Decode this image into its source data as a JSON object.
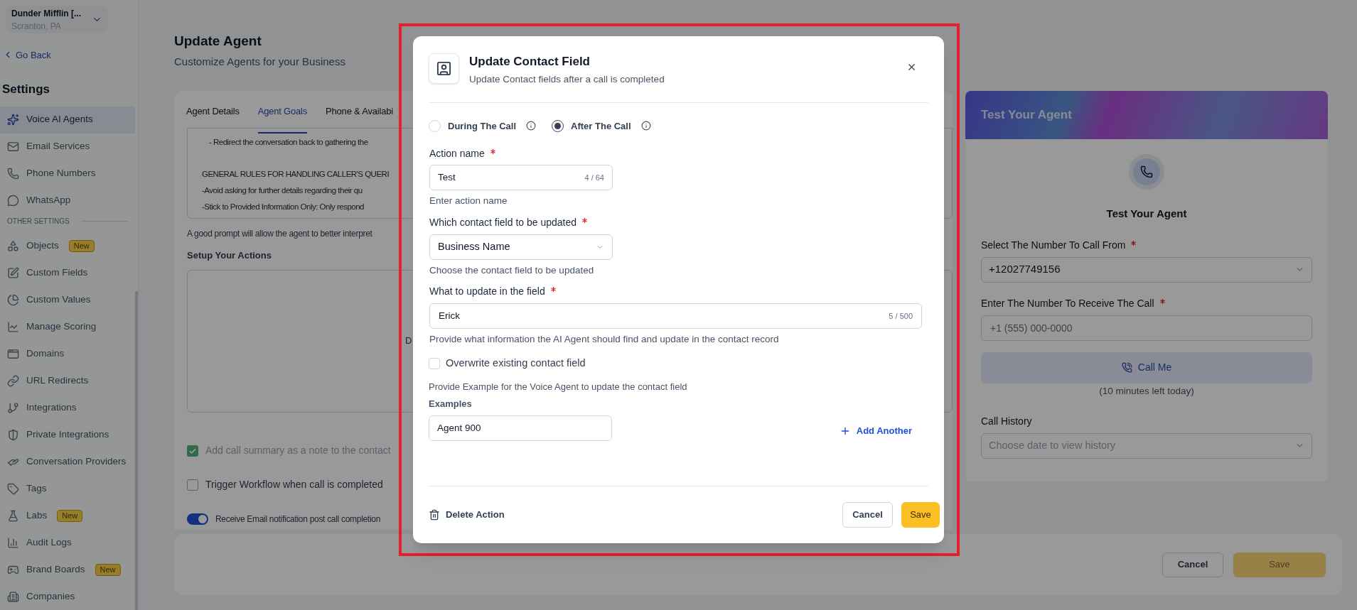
{
  "sidebar": {
    "account": {
      "name": "Dunder Mifflin [...",
      "location": "Scranton, PA"
    },
    "back_link": "Go Back",
    "title": "Settings",
    "items": [
      {
        "label": "Voice AI Agents",
        "selected": true
      },
      {
        "label": "Email Services",
        "selected": false
      },
      {
        "label": "Phone Numbers",
        "selected": false
      },
      {
        "label": "WhatsApp",
        "selected": false
      }
    ],
    "section_label": "OTHER SETTINGS",
    "other_items": [
      {
        "label": "Objects",
        "badge": "New",
        "selected": false
      },
      {
        "label": "Custom Fields",
        "selected": false
      },
      {
        "label": "Custom Values",
        "selected": false
      },
      {
        "label": "Manage Scoring",
        "selected": false
      },
      {
        "label": "Domains",
        "selected": false
      },
      {
        "label": "URL Redirects",
        "selected": false
      },
      {
        "label": "Integrations",
        "selected": false
      },
      {
        "label": "Private Integrations",
        "selected": false
      },
      {
        "label": "Conversation Providers",
        "selected": false
      },
      {
        "label": "Tags",
        "selected": false
      },
      {
        "label": "Labs",
        "badge": "New",
        "selected": false
      },
      {
        "label": "Audit Logs",
        "selected": false
      },
      {
        "label": "Brand Boards",
        "badge": "New",
        "selected": false
      },
      {
        "label": "Companies",
        "selected": false
      }
    ]
  },
  "page": {
    "title": "Update Agent",
    "subtitle": "Customize Agents for your Business",
    "tabs": [
      {
        "label": "Agent Details",
        "selected": false
      },
      {
        "label": "Agent Goals",
        "selected": true
      },
      {
        "label": "Phone & Availabi",
        "selected": false
      }
    ],
    "prompt_lines": [
      {
        "text": "- Redirect the conversation back to gathering the",
        "indent": true
      },
      {
        "text": "GENERAL RULES FOR HANDLING CALLER'S QUERI",
        "indent": false
      },
      {
        "text": "-Avoid asking for further details regarding their qu",
        "indent": false
      },
      {
        "text": "-Stick to Provided Information Only: Only respond",
        "indent": false
      }
    ],
    "prompt_hint": "A good prompt will allow the agent to better interpret",
    "actions_title": "Setup Your Actions",
    "actions_empty_text": "D",
    "options": [
      {
        "kind": "checkbox",
        "label": "Add call summary as a note to the contact",
        "checked": true,
        "disabled": true
      },
      {
        "kind": "checkbox",
        "label": "Trigger Workflow when call is completed",
        "checked": false,
        "disabled": false
      },
      {
        "kind": "toggle",
        "label": "Receive Email notification post call completion",
        "checked": true,
        "disabled": false
      }
    ],
    "cancel": "Cancel",
    "save": "Save"
  },
  "test_panel": {
    "header": "Test Your Agent",
    "title": "Test Your Agent",
    "from_label": "Select The Number To Call From",
    "from_value": "+12027749156",
    "to_label": "Enter The Number To Receive The Call",
    "to_placeholder": "+1 (555) 000-0000",
    "call_button": "Call Me",
    "minutes_note": "(10 minutes left today)",
    "history_label": "Call History",
    "history_placeholder": "Choose date to view history"
  },
  "modal": {
    "title": "Update Contact Field",
    "subtitle": "Update Contact fields after a call is completed",
    "timing": [
      {
        "label": "During The Call",
        "selected": false
      },
      {
        "label": "After The Call",
        "selected": true
      }
    ],
    "action_name": {
      "label": "Action name",
      "required": true,
      "value": "Test",
      "counter": "4 / 64",
      "help": "Enter action name"
    },
    "contact_field": {
      "label": "Which contact field to be updated",
      "required": true,
      "value": "Business Name",
      "help": "Choose the contact field to be updated"
    },
    "update_value": {
      "label": "What to update in the field",
      "required": true,
      "value": "Erick",
      "counter": "5 / 500",
      "help": "Provide what information the AI Agent should find and update in the contact record"
    },
    "overwrite": {
      "label": "Overwrite existing contact field",
      "checked": false
    },
    "examples_hint": "Provide Example for the Voice Agent to update the contact field",
    "examples_label": "Examples",
    "examples": [
      {
        "value": "Agent 900"
      }
    ],
    "add_another": "Add Another",
    "delete_action": "Delete Action",
    "cancel": "Cancel",
    "save": "Save"
  }
}
